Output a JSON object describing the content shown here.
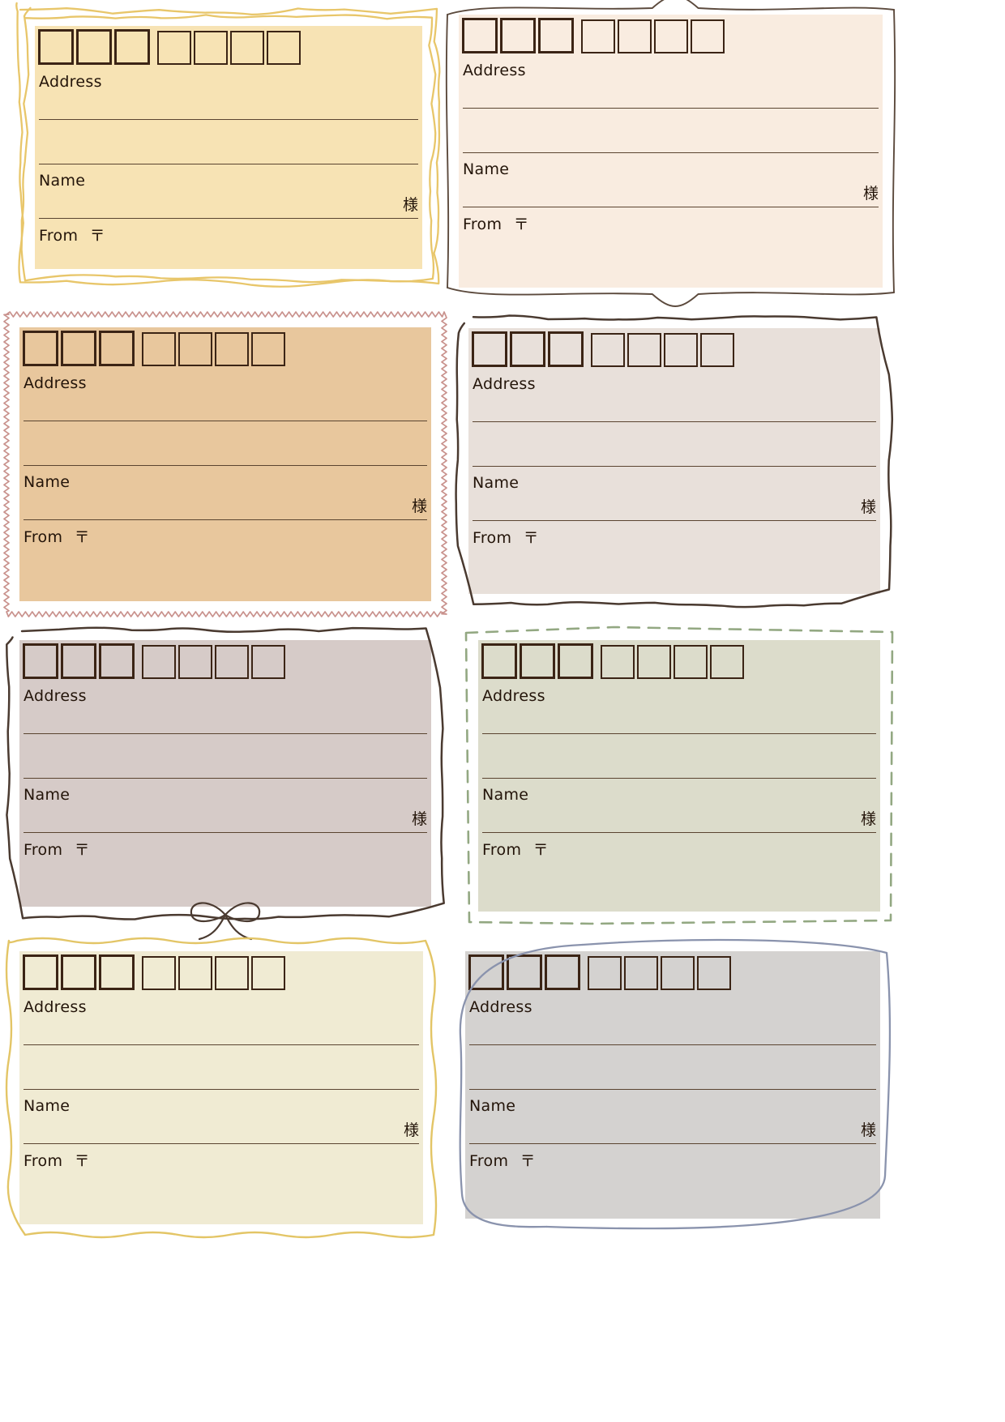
{
  "page": {
    "title": "Address Label Sheet",
    "background": "#ffffff",
    "columns": 2,
    "rows": 4,
    "card_count": 8
  },
  "labels": {
    "address": "Address",
    "name": "Name",
    "from": "From",
    "postal_mark": "〒",
    "honorific": "様"
  },
  "postal": {
    "box_count": 7,
    "thick_boxes": 3,
    "gap_after": 3,
    "box_border_color": "#3b2415"
  },
  "text_color": "#231409",
  "rule_color": "#5a4430",
  "cards": [
    {
      "id": "card-1",
      "position": "row1-left",
      "fill": "#f7e3b4",
      "border_style": "sketch-scribble",
      "border_color": "#e8c66a",
      "has_bow": false
    },
    {
      "id": "card-2",
      "position": "row1-right",
      "fill": "#f9ece0",
      "border_style": "curly-brace",
      "border_color": "#5c4a3d",
      "has_bow": false
    },
    {
      "id": "card-3",
      "position": "row2-left",
      "fill": "#e8c79d",
      "border_style": "sawtooth-zigzag",
      "border_color": "#c9928d",
      "has_bow": false
    },
    {
      "id": "card-4",
      "position": "row2-right",
      "fill": "#e8e0da",
      "border_style": "wobbly-hand-drawn",
      "border_color": "#4a3a30",
      "has_bow": false
    },
    {
      "id": "card-5",
      "position": "row3-left",
      "fill": "#d6cbc8",
      "border_style": "hand-drawn-ribbon",
      "border_color": "#4a3a30",
      "has_bow": true
    },
    {
      "id": "card-6",
      "position": "row3-right",
      "fill": "#dcdccb",
      "border_style": "dashed",
      "border_color": "#93a храм"
    },
    {
      "id": "card-7",
      "position": "row4-left",
      "fill": "#f0ebd3",
      "border_style": "wavy-line",
      "border_color": "#e3c566",
      "has_bow": false
    },
    {
      "id": "card-8",
      "position": "row4-right",
      "fill": "#d4d2d0",
      "border_style": "sketch-rounded",
      "border_color": "#8a93ad",
      "has_bow": false
    }
  ]
}
